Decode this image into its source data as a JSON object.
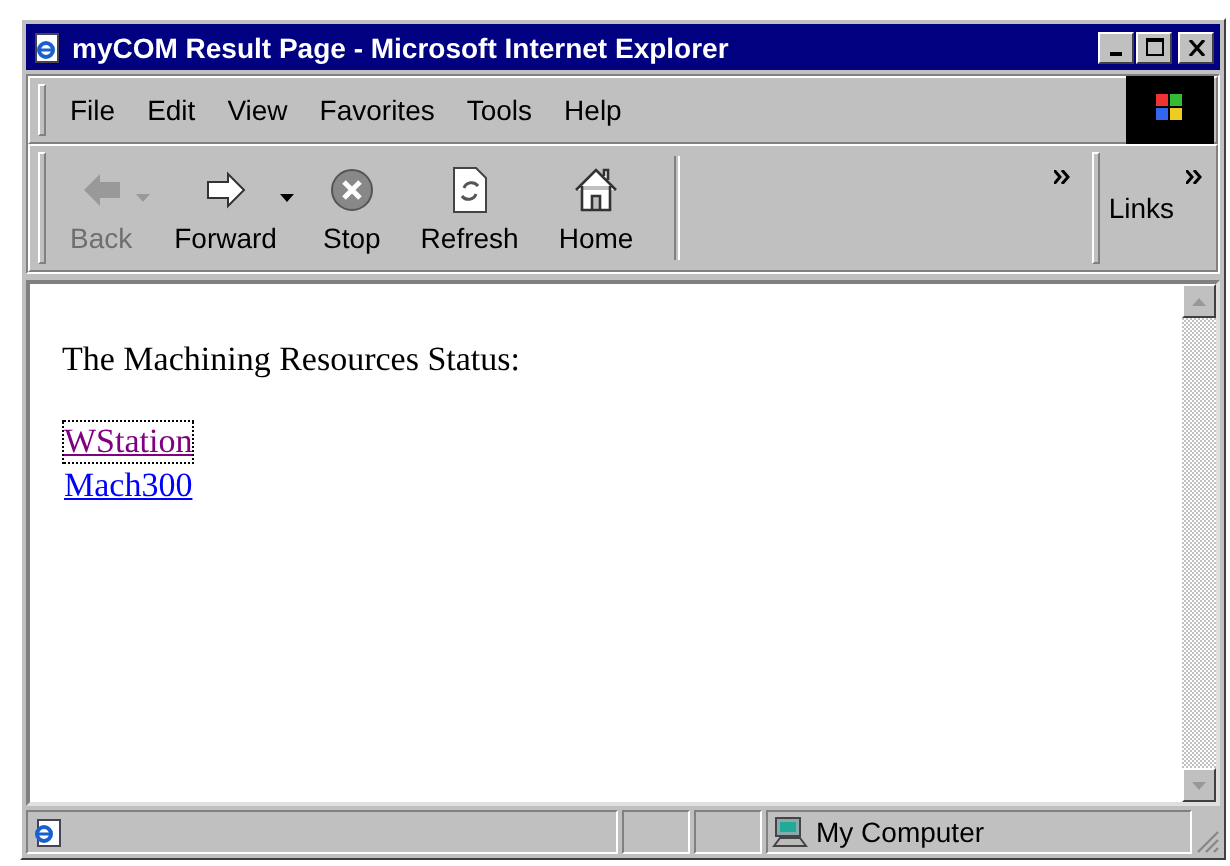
{
  "window": {
    "title": "myCOM Result Page - Microsoft Internet Explorer"
  },
  "menu": [
    "File",
    "Edit",
    "View",
    "Favorites",
    "Tools",
    "Help"
  ],
  "toolbar": [
    {
      "kind": "back",
      "label": "Back",
      "disabled": true,
      "dropdown": true
    },
    {
      "kind": "forward",
      "label": "Forward",
      "disabled": false,
      "dropdown": true
    },
    {
      "kind": "stop",
      "label": "Stop",
      "disabled": false,
      "dropdown": false
    },
    {
      "kind": "refresh",
      "label": "Refresh",
      "disabled": false,
      "dropdown": false
    },
    {
      "kind": "home",
      "label": "Home",
      "disabled": false,
      "dropdown": false
    }
  ],
  "links_bar": {
    "label": "Links"
  },
  "content": {
    "heading": "The Machining Resources Status:",
    "links": [
      {
        "text": "WStation",
        "visited": true,
        "focused": true
      },
      {
        "text": "Mach300",
        "visited": false,
        "focused": false
      }
    ]
  },
  "status_bar": {
    "zone": "My Computer"
  }
}
